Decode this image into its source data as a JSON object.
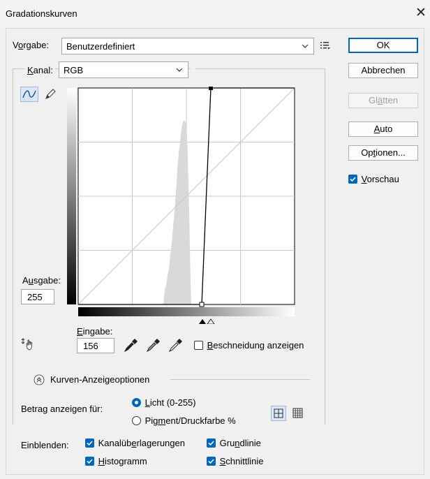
{
  "window": {
    "title": "Gradationskurven"
  },
  "preset": {
    "label": "Vorgabe:",
    "value": "Benutzerdefiniert"
  },
  "channel": {
    "label": "Kanal:",
    "value": "RGB"
  },
  "buttons": {
    "ok": "OK",
    "cancel": "Abbrechen",
    "smooth": "Glätten",
    "auto": "Auto",
    "options": "Optionen..."
  },
  "preview": {
    "label": "Vorschau",
    "checked": true
  },
  "output": {
    "label": "Ausgabe:",
    "value": "255"
  },
  "input": {
    "label": "Eingabe:",
    "value": "156"
  },
  "clipping": {
    "label": "Beschneidung anzeigen",
    "checked": false
  },
  "display_options": {
    "label": "Kurven-Anzeigeoptionen"
  },
  "amount": {
    "label": "Betrag anzeigen für:",
    "light": "Licht (0-255)",
    "pigment": "Pigment/Druckfarbe %",
    "selected": "light"
  },
  "show": {
    "label": "Einblenden:",
    "channel_overlays": "Kanalüberlagerungen",
    "baseline": "Grundlinie",
    "histogram": "Histogramm",
    "intersection": "Schnittlinie"
  },
  "curve": {
    "input_black": 0,
    "input_white": 156,
    "output_black": 0,
    "output_white": 255
  },
  "colors": {
    "accent": "#0067c0",
    "grid": "#c8c8c8",
    "histogram": "#d9d9d9"
  }
}
